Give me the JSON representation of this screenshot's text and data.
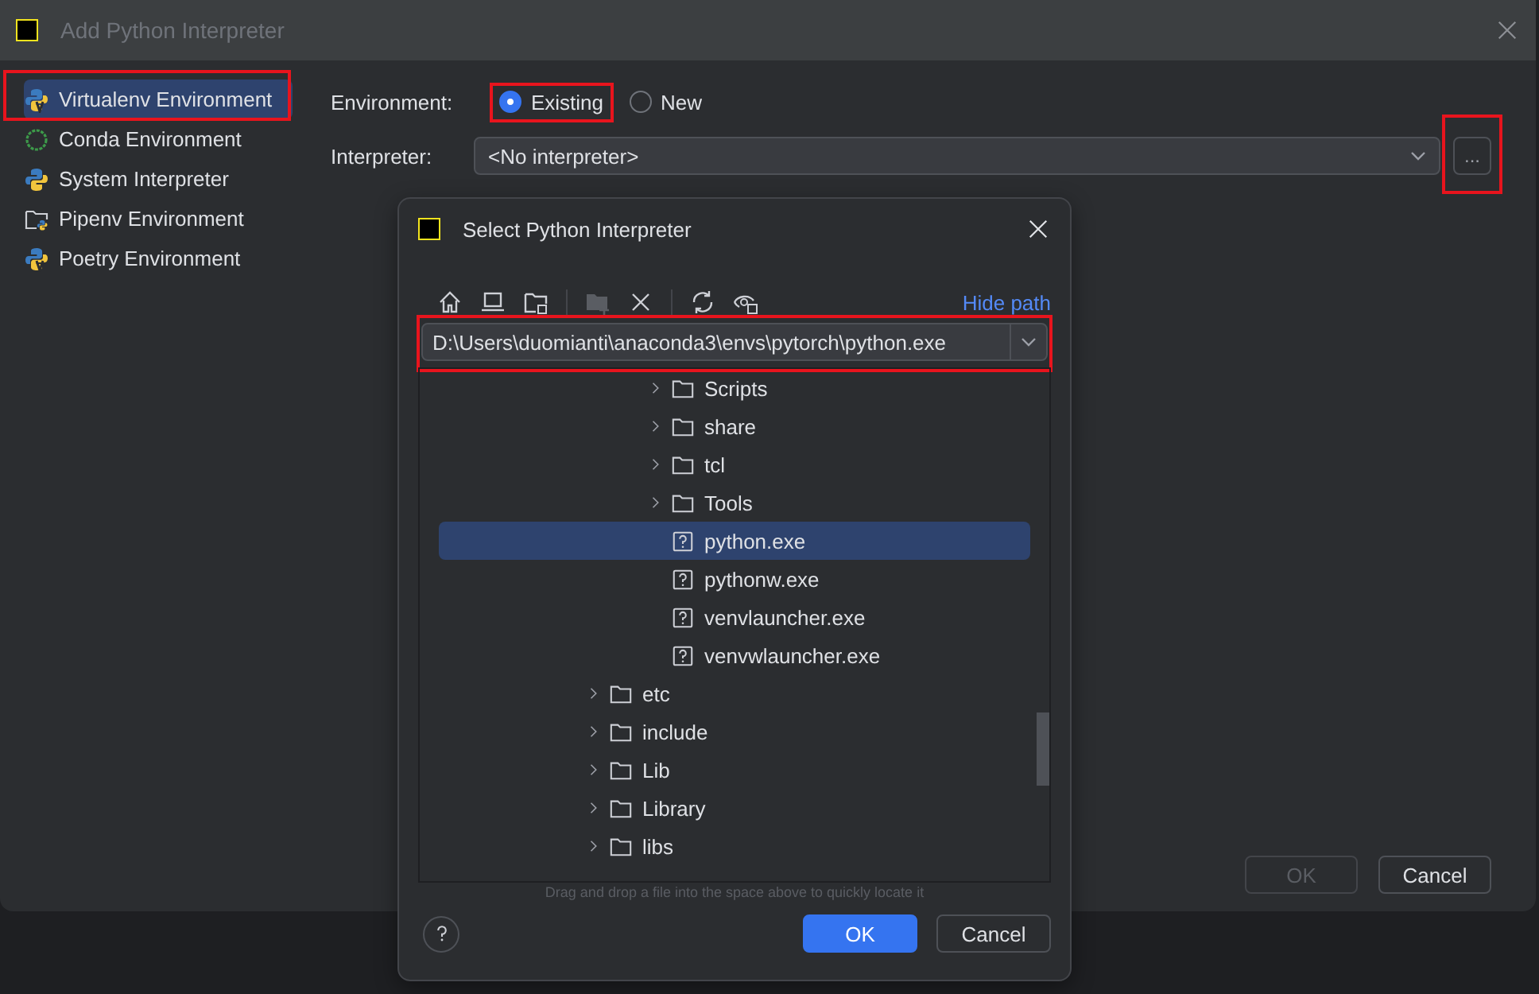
{
  "window": {
    "title": "Add Python Interpreter"
  },
  "sidebar": {
    "items": [
      {
        "label": "Virtualenv Environment",
        "kind": "virtualenv",
        "selected": true,
        "highlighted": true
      },
      {
        "label": "Conda Environment",
        "kind": "conda",
        "selected": false,
        "highlighted": false
      },
      {
        "label": "System Interpreter",
        "kind": "python",
        "selected": false,
        "highlighted": false
      },
      {
        "label": "Pipenv Environment",
        "kind": "pipenv",
        "selected": false,
        "highlighted": false
      },
      {
        "label": "Poetry Environment",
        "kind": "virtualenv",
        "selected": false,
        "highlighted": false
      }
    ]
  },
  "environment": {
    "label": "Environment:",
    "options": [
      {
        "label": "Existing",
        "selected": true,
        "highlighted": true
      },
      {
        "label": "New",
        "selected": false,
        "highlighted": false
      }
    ]
  },
  "interpreter": {
    "label": "Interpreter:",
    "value": "<No interpreter>",
    "browse_button": {
      "label": "...",
      "highlighted": true
    }
  },
  "buttons": [
    {
      "label": "OK",
      "disabled": true
    },
    {
      "label": "Cancel",
      "disabled": false
    }
  ],
  "file_dialog": {
    "title": "Select Python Interpreter",
    "hide_path_link": "Hide path",
    "path": {
      "value": "D:\\Users\\duomianti\\anaconda3\\envs\\pytorch\\python.exe",
      "highlighted": true
    },
    "tree": [
      {
        "children": [
          {
            "label": "Scripts",
            "kind": "folder",
            "selected": false
          },
          {
            "label": "share",
            "kind": "folder",
            "selected": false
          },
          {
            "label": "tcl",
            "kind": "folder",
            "selected": false
          },
          {
            "label": "Tools",
            "kind": "folder",
            "selected": false
          },
          {
            "label": "python.exe",
            "kind": "file",
            "selected": true
          },
          {
            "label": "pythonw.exe",
            "kind": "file",
            "selected": false
          },
          {
            "label": "venvlauncher.exe",
            "kind": "file",
            "selected": false
          },
          {
            "label": "venvwlauncher.exe",
            "kind": "file",
            "selected": false
          }
        ]
      },
      {
        "label": "etc",
        "kind": "folder",
        "selected": false
      },
      {
        "label": "include",
        "kind": "folder",
        "selected": false
      },
      {
        "label": "Lib",
        "kind": "folder",
        "selected": false
      },
      {
        "label": "Library",
        "kind": "folder",
        "selected": false
      },
      {
        "label": "libs",
        "kind": "folder",
        "selected": false
      }
    ],
    "hint": "Drag and drop a file into the space above to quickly locate it",
    "buttons": [
      {
        "label": "OK",
        "kind": "primary"
      },
      {
        "label": "Cancel",
        "kind": "secondary"
      }
    ]
  }
}
